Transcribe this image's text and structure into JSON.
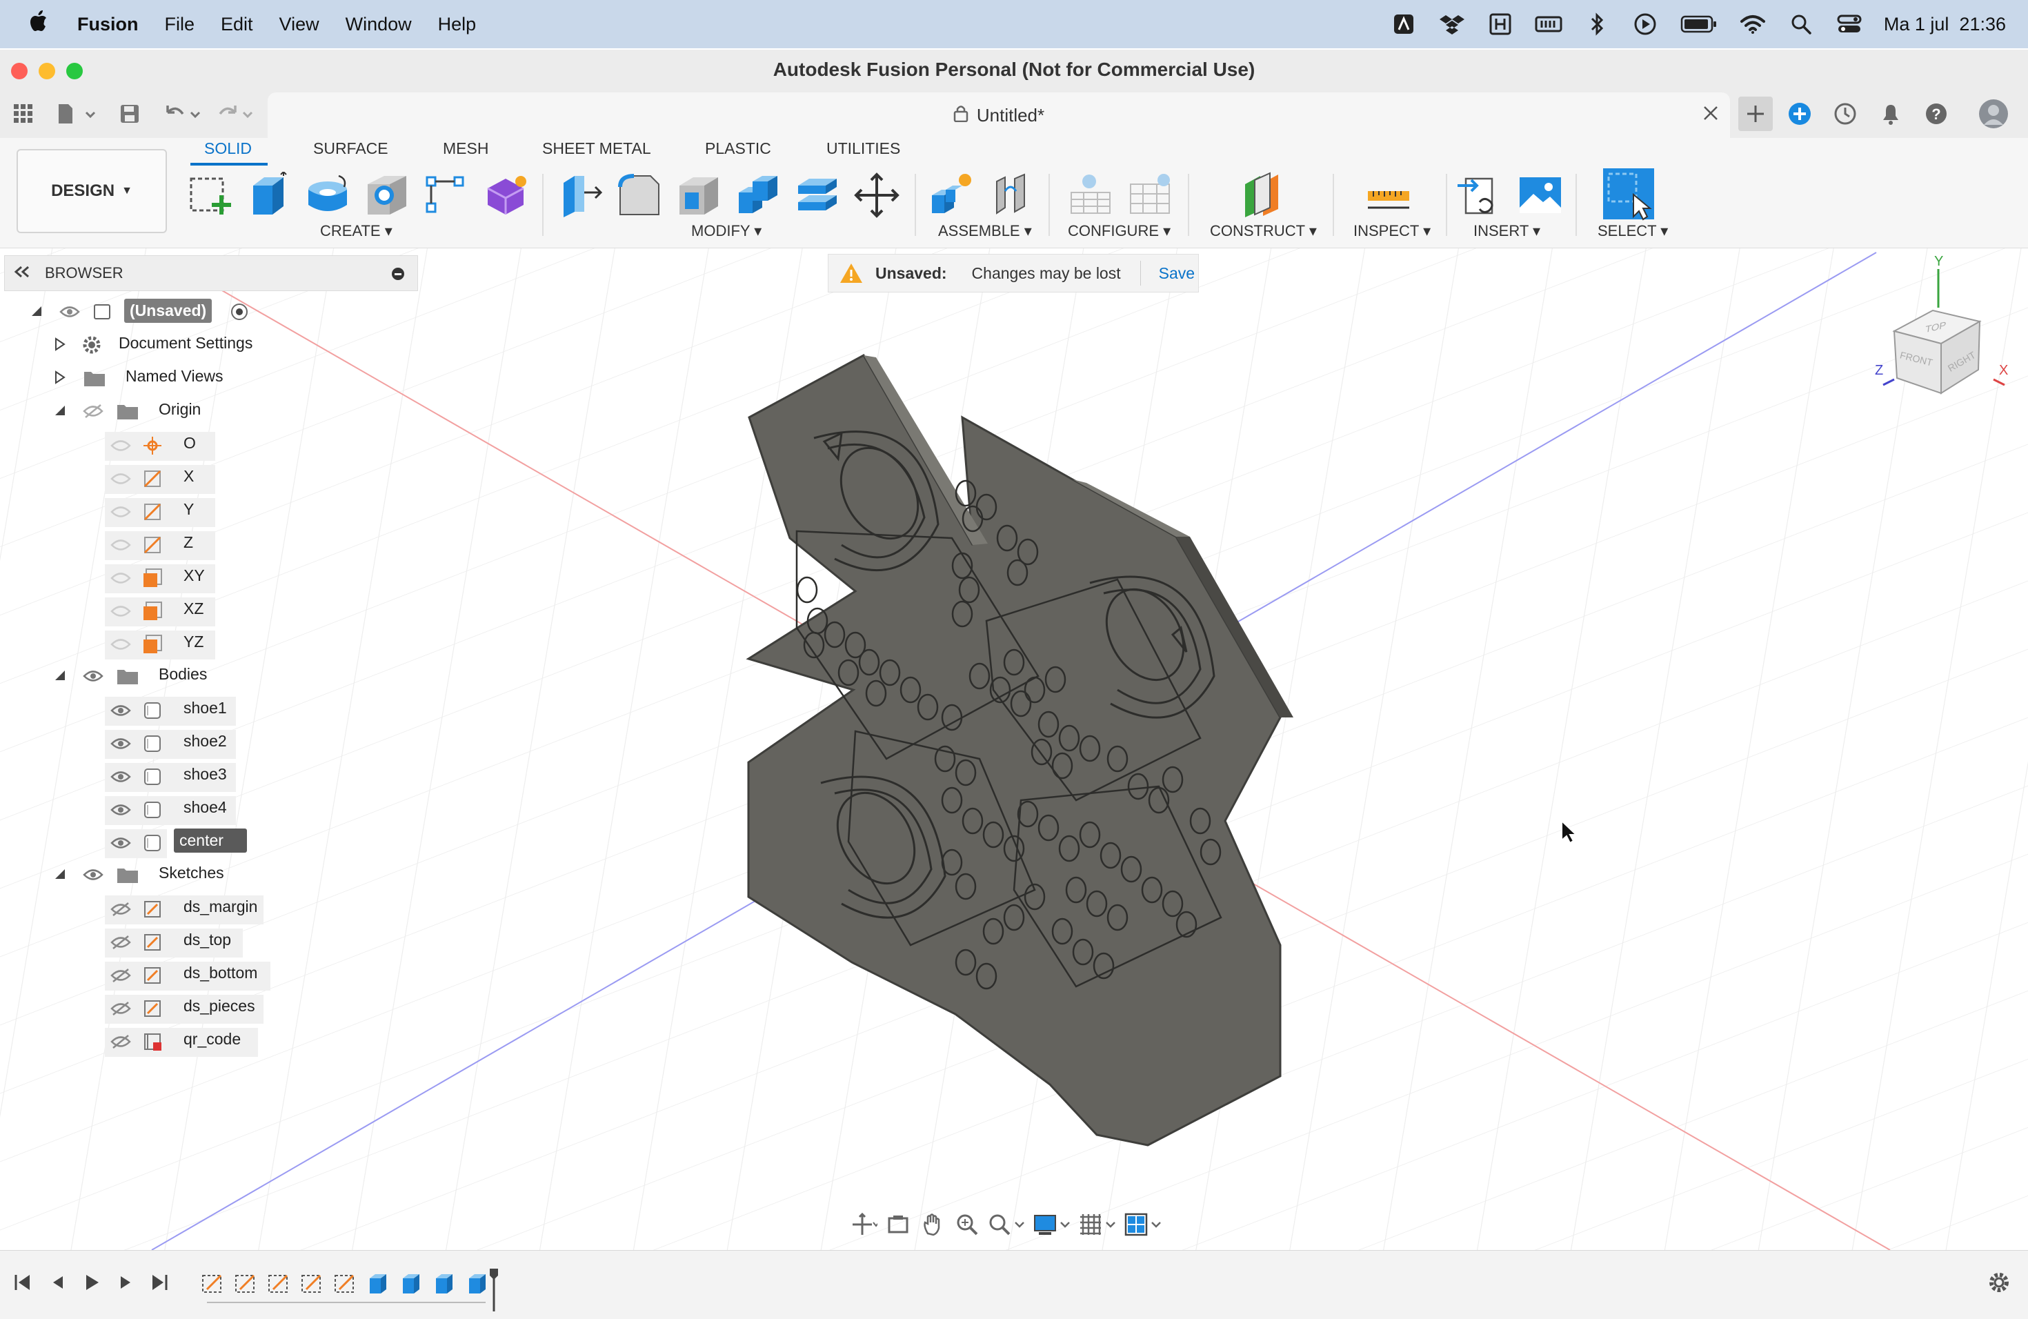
{
  "menubar": {
    "apple_icon": "apple-logo-icon",
    "app_name": "Fusion",
    "items": [
      "File",
      "Edit",
      "View",
      "Window",
      "Help"
    ],
    "status_icons": [
      "autodesk-icon",
      "dropbox-icon",
      "hyperkey-icon",
      "memory-icon",
      "bluetooth-icon",
      "play-icon",
      "battery-icon",
      "wifi-icon",
      "spotlight-search-icon",
      "control-center-icon"
    ],
    "datetime": "Ma 1 jul  21:36"
  },
  "window": {
    "title": "Autodesk Fusion Personal (Not for Commercial Use)"
  },
  "tabrow": {
    "doc_title": "Untitled*",
    "quick_icons": [
      "grid-menu-icon",
      "file-menu-icon",
      "save-icon",
      "undo-icon",
      "redo-icon"
    ],
    "right_icons": [
      "new-tab-icon",
      "extensions-icon",
      "job-status-icon",
      "notifications-icon",
      "help-icon",
      "profile-avatar-icon"
    ]
  },
  "ribbon": {
    "workspace": "DESIGN",
    "tabs": [
      "SOLID",
      "SURFACE",
      "MESH",
      "SHEET METAL",
      "PLASTIC",
      "UTILITIES"
    ],
    "active_tab": "SOLID",
    "groups": [
      "CREATE",
      "MODIFY",
      "ASSEMBLE",
      "CONFIGURE",
      "CONSTRUCT",
      "INSPECT",
      "INSERT",
      "SELECT"
    ]
  },
  "banner": {
    "label": "Unsaved:",
    "message": "Changes may be lost",
    "action": "Save"
  },
  "browser": {
    "title": "BROWSER",
    "root": "(Unsaved)",
    "document_settings": "Document Settings",
    "named_views": "Named Views",
    "origin": "Origin",
    "origin_items": [
      "O",
      "X",
      "Y",
      "Z",
      "XY",
      "XZ",
      "YZ"
    ],
    "bodies": "Bodies",
    "body_items": [
      "shoe1",
      "shoe2",
      "shoe3",
      "shoe4",
      "center"
    ],
    "selected_body": "center",
    "sketches": "Sketches",
    "sketch_items": [
      "ds_margin",
      "ds_top",
      "ds_bottom",
      "ds_pieces",
      "qr_code"
    ]
  },
  "viewcube": {
    "top": "TOP",
    "front": "FRONT",
    "right": "RIGHT",
    "axis_x": "X",
    "axis_y": "Y",
    "axis_z": "Z"
  },
  "colors": {
    "accent": "#0a73c9",
    "menubar": "#c9d8ea",
    "model_face": "#63625d",
    "model_side": "#4d4c48"
  }
}
